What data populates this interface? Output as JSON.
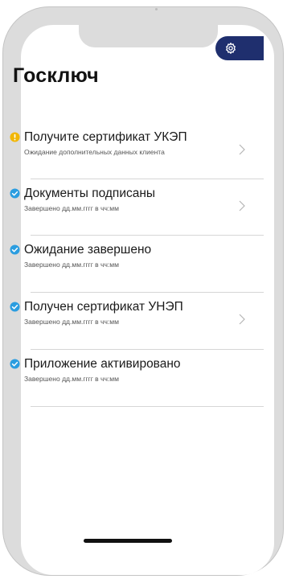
{
  "app": {
    "title": "Госключ"
  },
  "header": {
    "settings_icon": "gear-icon",
    "accent_color": "#1f2f6e"
  },
  "steps": [
    {
      "title": "Получите сертификат УКЭП",
      "subtitle": "Ожидание дополнительных данных клиента",
      "status": "warning",
      "status_icon": "exclamation-circle-icon",
      "status_color": "#f2b705",
      "has_chevron": true
    },
    {
      "title": "Документы подписаны",
      "subtitle": "Завершено дд.мм.гггг в чч:мм",
      "status": "done",
      "status_icon": "check-circle-icon",
      "status_color": "#2b9de0",
      "has_chevron": true
    },
    {
      "title": "Ожидание завершено",
      "subtitle": "Завершено дд.мм.гггг в чч:мм",
      "status": "done",
      "status_icon": "check-circle-icon",
      "status_color": "#2b9de0",
      "has_chevron": false
    },
    {
      "title": "Получен сертификат УНЭП",
      "subtitle": "Завершено дд.мм.гггг в чч:мм",
      "status": "done",
      "status_icon": "check-circle-icon",
      "status_color": "#2b9de0",
      "has_chevron": true
    },
    {
      "title": "Приложение активировано",
      "subtitle": "Завершено дд.мм.гггг в чч:мм",
      "status": "done",
      "status_icon": "check-circle-icon",
      "status_color": "#2b9de0",
      "has_chevron": false
    }
  ]
}
